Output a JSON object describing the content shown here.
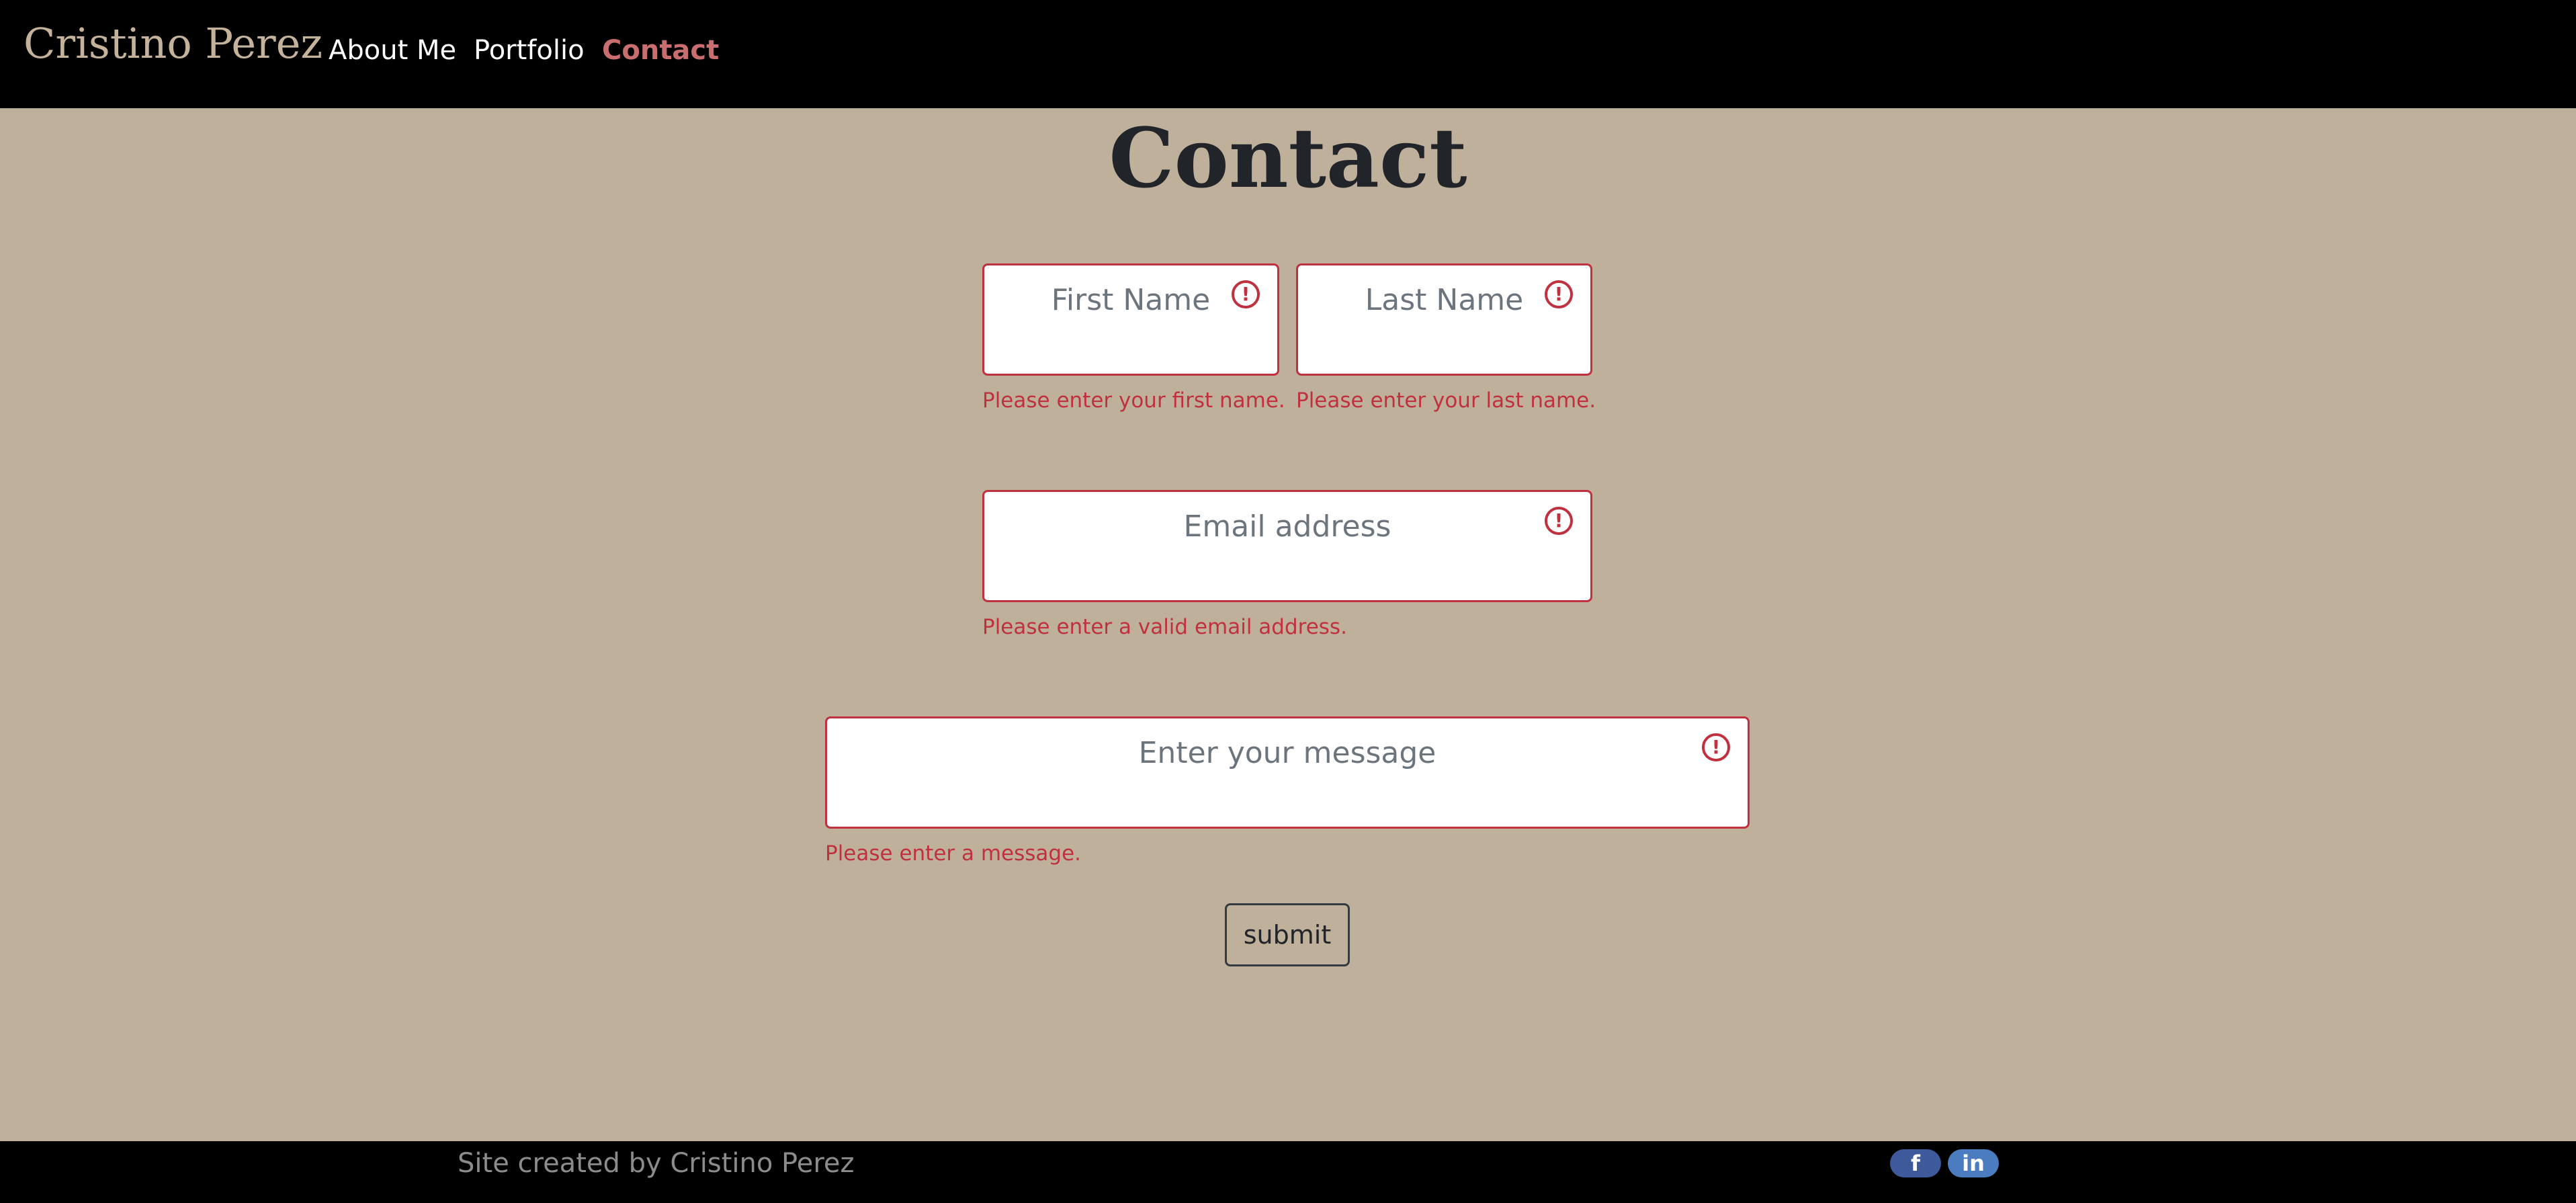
{
  "nav": {
    "brand": "Cristino Perez",
    "links": [
      {
        "label": "About Me",
        "active": false
      },
      {
        "label": "Portfolio",
        "active": false
      },
      {
        "label": "Contact",
        "active": true
      }
    ]
  },
  "page": {
    "title": "Contact"
  },
  "form": {
    "first_name": {
      "placeholder": "First Name",
      "value": "",
      "error": "Please enter your first name."
    },
    "last_name": {
      "placeholder": "Last Name",
      "value": "",
      "error": "Please enter your last name."
    },
    "email": {
      "placeholder": "Email address",
      "value": "",
      "error": "Please enter a valid email address."
    },
    "message": {
      "placeholder": "Enter your message",
      "value": "",
      "error": "Please enter a message."
    },
    "submit_label": "submit",
    "error_icon": "!"
  },
  "footer": {
    "text": "Site created by Cristino Perez",
    "social": [
      {
        "icon": "facebook-icon",
        "glyph": "f"
      },
      {
        "icon": "linkedin-icon",
        "glyph": "in"
      }
    ]
  },
  "colors": {
    "background": "#bfb09c",
    "navbar": "#000000",
    "accent": "#c96e6e",
    "error": "#c0313f"
  }
}
